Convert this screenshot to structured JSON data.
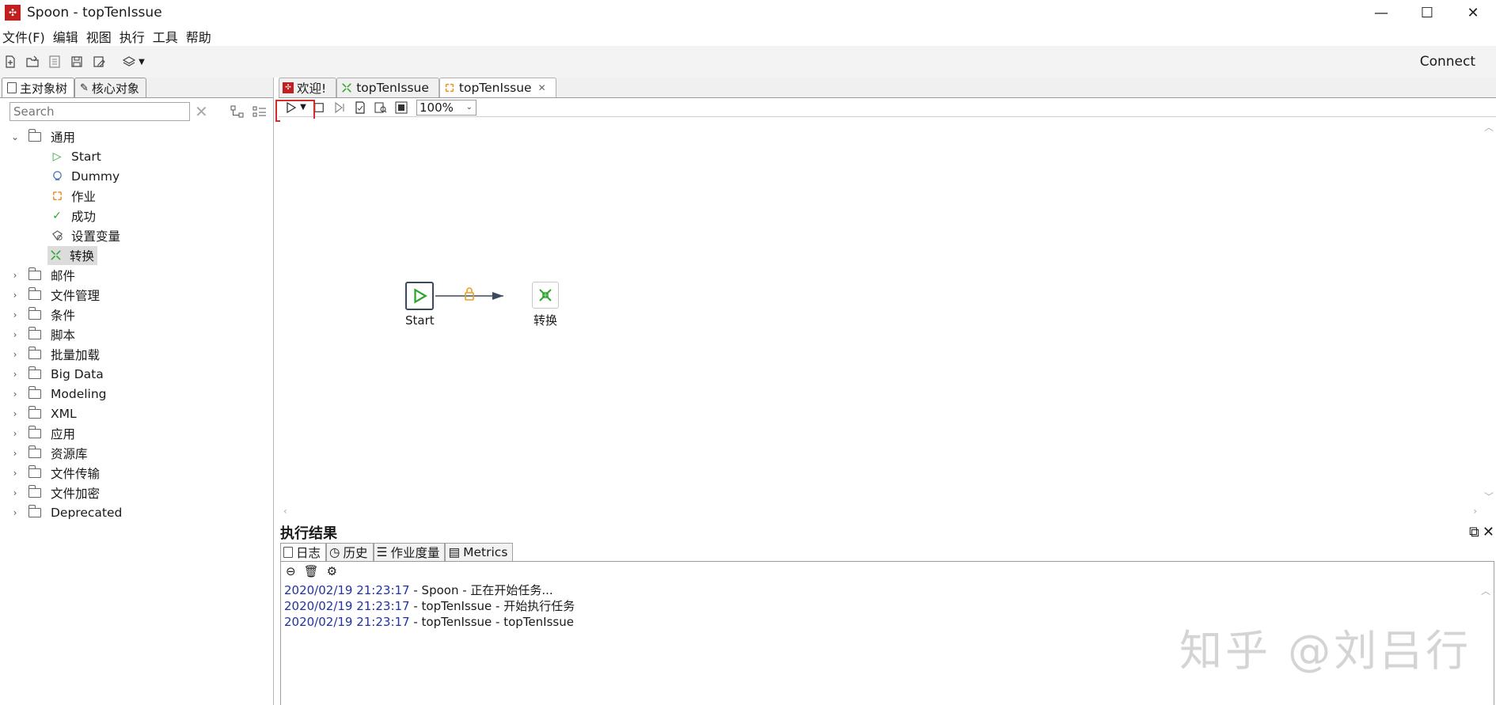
{
  "window": {
    "title": "Spoon - topTenIssue",
    "minimize": "—",
    "maximize": "☐",
    "close": "✕"
  },
  "menu": [
    "文件(F)",
    "编辑",
    "视图",
    "执行",
    "工具",
    "帮助"
  ],
  "toolbar": {
    "connect_label": "Connect"
  },
  "left_panel": {
    "tabs": [
      "主对象树",
      "核心对象"
    ],
    "search_placeholder": "Search",
    "tree": {
      "expanded_folder": "通用",
      "children": [
        "Start",
        "Dummy",
        "作业",
        "成功",
        "设置变量",
        "转换"
      ],
      "selected_child": "转换",
      "collapsed_folders": [
        "邮件",
        "文件管理",
        "条件",
        "脚本",
        "批量加载",
        "Big Data",
        "Modeling",
        "XML",
        "应用",
        "资源库",
        "文件传输",
        "文件加密",
        "Deprecated"
      ]
    }
  },
  "editor": {
    "tabs": [
      {
        "label": "欢迎!",
        "active": false
      },
      {
        "label": "topTenIssue",
        "active": false
      },
      {
        "label": "topTenIssue",
        "active": true
      }
    ],
    "zoom": "100%",
    "steps": [
      {
        "label": "Start"
      },
      {
        "label": "转换"
      }
    ]
  },
  "results": {
    "title": "执行结果",
    "tabs": [
      "日志",
      "历史",
      "作业度量",
      "Metrics"
    ],
    "log": [
      {
        "ts": "2020/02/19 21:23:17",
        "msg": " - Spoon - 正在开始任务..."
      },
      {
        "ts": "2020/02/19 21:23:17",
        "msg": " - topTenIssue - 开始执行任务"
      },
      {
        "ts": "2020/02/19 21:23:17",
        "msg": " - topTenIssue - topTenIssue"
      }
    ]
  },
  "watermark": "知乎 @刘吕行",
  "colors": {
    "accent_red": "#d62b2b",
    "log_timestamp": "#2233a0",
    "start_green": "#2aa52a"
  }
}
